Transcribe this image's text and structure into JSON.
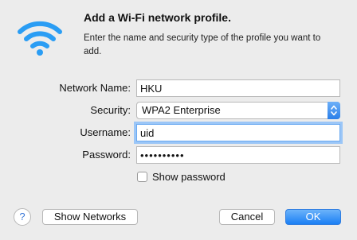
{
  "dialog": {
    "title": "Add a Wi-Fi network profile.",
    "description": "Enter the name and security type of the profile you want to add."
  },
  "form": {
    "network_name": {
      "label": "Network Name:",
      "value": "HKU"
    },
    "security": {
      "label": "Security:",
      "selected": "WPA2 Enterprise"
    },
    "username": {
      "label": "Username:",
      "value": "uid"
    },
    "password": {
      "label": "Password:",
      "masked_value": "••••••••••"
    },
    "show_password": {
      "label": "Show password",
      "checked": false
    }
  },
  "buttons": {
    "help": "?",
    "show_networks": "Show Networks",
    "cancel": "Cancel",
    "ok": "OK"
  },
  "icons": {
    "wifi": "wifi-icon"
  },
  "colors": {
    "accent": "#1b7ff4",
    "wifi": "#2a9df4",
    "focus_ring": "#9bc6f7"
  }
}
